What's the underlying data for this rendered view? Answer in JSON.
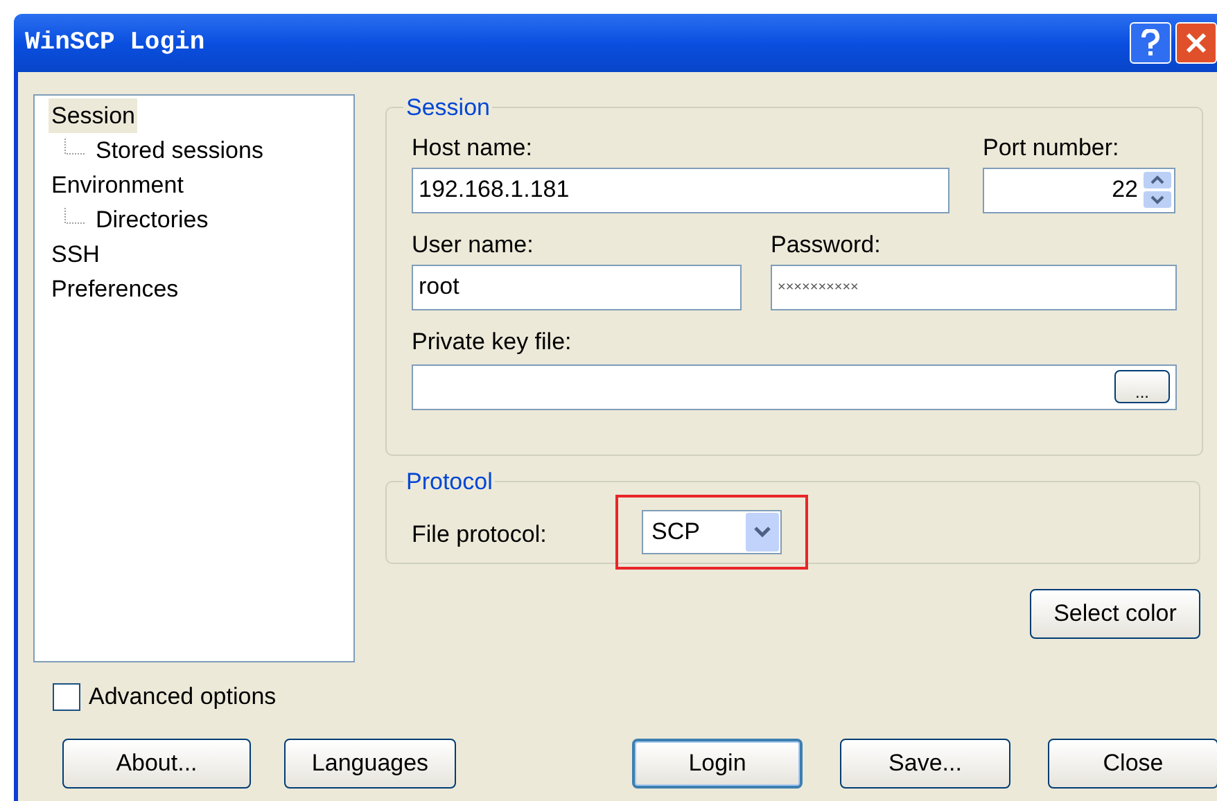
{
  "window": {
    "title": "WinSCP Login"
  },
  "tree": {
    "items": [
      {
        "label": "Session",
        "selected": true,
        "children": [
          {
            "label": "Stored sessions",
            "selected": false
          }
        ]
      },
      {
        "label": "Environment",
        "selected": false,
        "children": [
          {
            "label": "Directories",
            "selected": false
          }
        ]
      },
      {
        "label": "SSH",
        "selected": false
      },
      {
        "label": "Preferences",
        "selected": false
      }
    ]
  },
  "session": {
    "title": "Session",
    "host_label": "Host name:",
    "host_value": "192.168.1.181",
    "port_label": "Port number:",
    "port_value": "22",
    "user_label": "User name:",
    "user_value": "root",
    "password_label": "Password:",
    "password_value": "××××××××××",
    "key_label": "Private key file:",
    "browse": "..."
  },
  "protocol": {
    "title": "Protocol",
    "label": "File protocol:",
    "value": "SCP",
    "highlighted": true
  },
  "select_color": "Select color",
  "advanced": {
    "label": "Advanced options",
    "checked": false
  },
  "buttons": [
    {
      "label": "About...",
      "default": false
    },
    {
      "label": "Languages",
      "default": false
    },
    {
      "label": "Login",
      "default": true
    },
    {
      "label": "Save...",
      "default": false
    },
    {
      "label": "Close",
      "default": false
    }
  ]
}
